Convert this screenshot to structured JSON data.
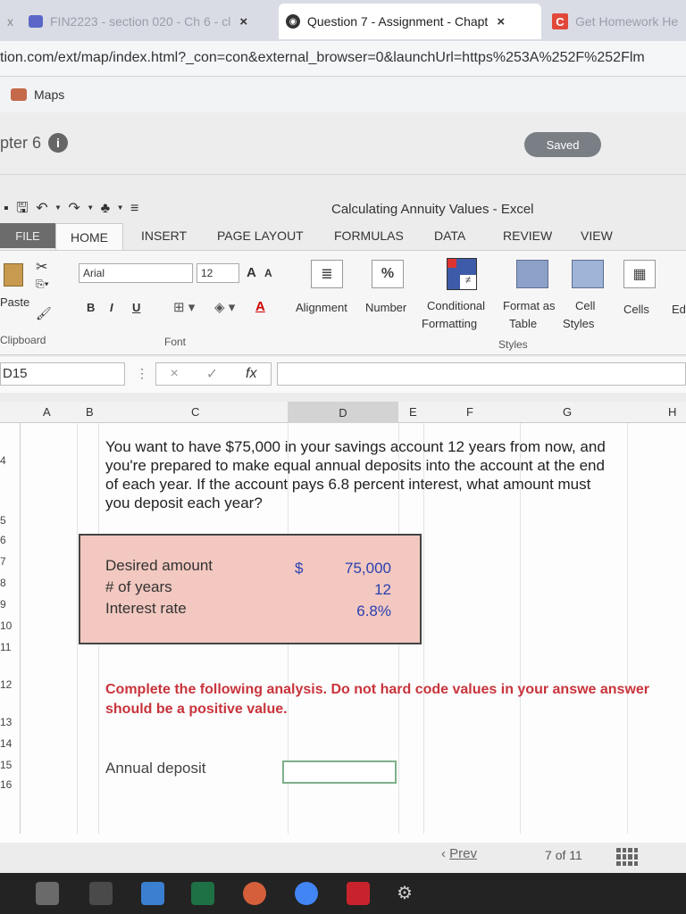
{
  "browser": {
    "tabs": [
      {
        "label": "FIN2223 - section 020 - Ch 6 - cl",
        "close": "×"
      },
      {
        "label": "Question 7 - Assignment - Chapt",
        "close": "×"
      },
      {
        "label": "Get Homework He"
      }
    ],
    "url": "tion.com/ext/map/index.html?_con=con&external_browser=0&launchUrl=https%253A%252F%252Flm",
    "bookmark": "Maps"
  },
  "page": {
    "chapter": "pter 6",
    "info_icon": "i",
    "saved": "Saved"
  },
  "excel": {
    "title": "Calculating Annuity Values - Excel",
    "tabs": {
      "file": "FILE",
      "home": "HOME",
      "insert": "INSERT",
      "page_layout": "PAGE LAYOUT",
      "formulas": "FORMULAS",
      "data": "DATA",
      "review": "REVIEW",
      "view": "VIEW"
    },
    "ribbon": {
      "paste": "Paste",
      "font_name": "Arial",
      "font_size": "12",
      "grow_font": "A",
      "shrink_font": "A",
      "bold": "B",
      "italic": "I",
      "underline": "U",
      "alignment": "Alignment",
      "number": "Number",
      "conditional_1": "Conditional",
      "conditional_2": "Formatting",
      "format_as_1": "Format as",
      "format_as_2": "Table",
      "cell_styles_1": "Cell",
      "cell_styles_2": "Styles",
      "cells": "Cells",
      "editing": "Ed",
      "percent": "%",
      "neq": "≠",
      "clipboard": "Clipboard",
      "font": "Font",
      "styles": "Styles"
    },
    "name_box": "D15",
    "fx": "fx",
    "cancel": "×",
    "enter": "✓",
    "columns": [
      "A",
      "B",
      "C",
      "D",
      "E",
      "F",
      "G",
      "H"
    ],
    "rows": [
      "4",
      "5",
      "6",
      "7",
      "8",
      "9",
      "10",
      "11",
      "12",
      "13",
      "14",
      "15",
      "16"
    ],
    "question": "You want to have $75,000 in your savings account 12 years from now, and you're prepared to make equal annual deposits into the account at the end of each year. If the account pays 6.8 percent interest, what amount must you deposit each year?",
    "inputs": {
      "desired_label": "Desired amount",
      "desired_symbol": "$",
      "desired_value": "75,000",
      "years_label": "# of years",
      "years_value": "12",
      "rate_label": "Interest rate",
      "rate_value": "6.8%"
    },
    "instruction": "Complete the following analysis. Do not hard code values in your answe answer should be a positive value.",
    "annual_deposit_label": "Annual deposit",
    "annual_deposit_value": ""
  },
  "nav": {
    "prev": "Prev",
    "page": "7",
    "of": "of",
    "total": "11"
  }
}
